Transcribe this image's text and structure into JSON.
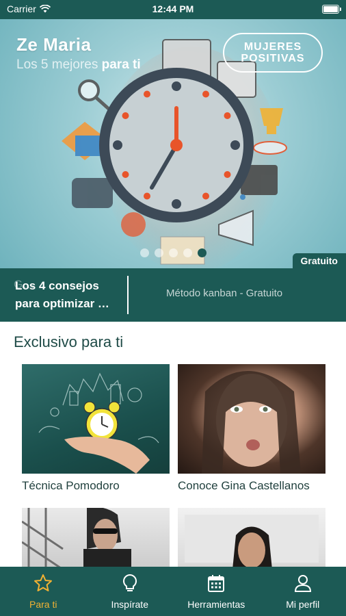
{
  "status_bar": {
    "carrier": "Carrier",
    "time": "12:44 PM"
  },
  "hero": {
    "title": "Ze Maria",
    "subtitle_light": "Los 5 mejores",
    "subtitle_bold": "para ti",
    "logo_line1": "MUJERES",
    "logo_line2": "POSITIVAS",
    "badge": "Gratuito",
    "slides": 5,
    "active_slide": 5
  },
  "featured": {
    "left_title": "Los 4 consejos para optimizar …",
    "ghost_text": "G…",
    "right_text": "Método kanban - Gratuito"
  },
  "section": {
    "title": "Exclusivo para ti"
  },
  "cards": [
    {
      "label": "Técnica Pomodoro"
    },
    {
      "label": "Conoce Gina Castellanos"
    },
    {
      "label": ""
    },
    {
      "label": ""
    }
  ],
  "tabs": [
    {
      "label": "Para ti",
      "icon": "star-icon",
      "active": true
    },
    {
      "label": "Inspírate",
      "icon": "lightbulb-icon",
      "active": false
    },
    {
      "label": "Herramientas",
      "icon": "calendar-icon",
      "active": false
    },
    {
      "label": "Mi perfil",
      "icon": "person-icon",
      "active": false
    }
  ],
  "colors": {
    "brand": "#1c5a55",
    "accent": "#f2b233",
    "clock_orange": "#e8542a"
  }
}
